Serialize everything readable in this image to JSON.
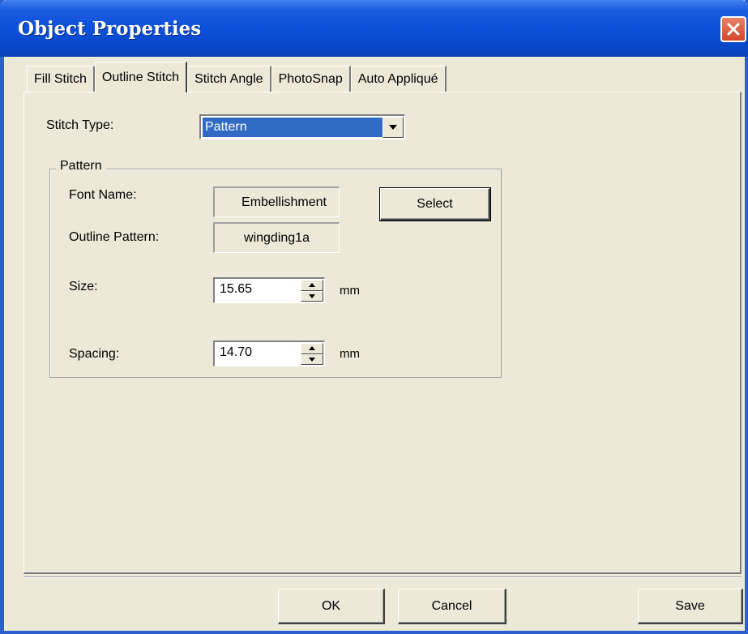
{
  "window": {
    "title": "Object Properties"
  },
  "tabs": [
    {
      "label": "Fill Stitch"
    },
    {
      "label": "Outline Stitch",
      "active": true
    },
    {
      "label": "Stitch Angle"
    },
    {
      "label": "PhotoSnap"
    },
    {
      "label": "Auto Appliqué"
    }
  ],
  "stitch_type": {
    "label": "Stitch Type:",
    "value": "Pattern"
  },
  "pattern_group": {
    "title": "Pattern",
    "font_name_label": "Font Name:",
    "font_name_value": "Embellishment",
    "outline_pattern_label": "Outline Pattern:",
    "outline_pattern_value": "wingding1a",
    "select_label": "Select",
    "size_label": "Size:",
    "size_value": "15.65",
    "size_unit": "mm",
    "spacing_label": "Spacing:",
    "spacing_value": "14.70",
    "spacing_unit": "mm"
  },
  "buttons": {
    "ok": "OK",
    "cancel": "Cancel",
    "save": "Save"
  },
  "icons": {
    "close": "close-icon",
    "dropdown": "chevron-down-icon",
    "spin_up": "spin-up-icon",
    "spin_down": "spin-down-icon"
  },
  "colors": {
    "titlebar": "#0c4fd8",
    "dialog_bg": "#ece9d8",
    "selection": "#316ac5",
    "close_button": "#d4452a"
  }
}
